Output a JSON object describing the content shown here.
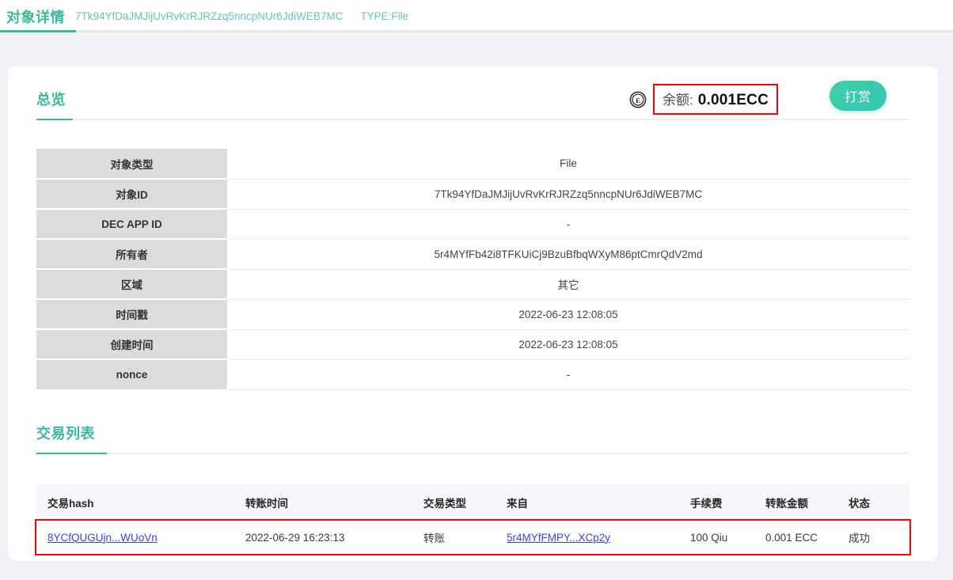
{
  "header": {
    "tab_label": "对象详情",
    "object_id": "7Tk94YfDaJMJijUvRvKrRJRZzq5nncpNUr6JdiWEB7MC",
    "type_label": "TYPE:File"
  },
  "overview": {
    "section_title": "总览",
    "balance_label": "余额:",
    "balance_value": "0.001ECC",
    "coin_icon": "ecc-coin-icon",
    "reward_button": "打赏",
    "rows": [
      {
        "label": "对象类型",
        "value": "File"
      },
      {
        "label": "对象ID",
        "value": "7Tk94YfDaJMJijUvRvKrRJRZzq5nncpNUr6JdiWEB7MC"
      },
      {
        "label": "DEC APP ID",
        "value": "-"
      },
      {
        "label": "所有者",
        "value": "5r4MYfFb42i8TFKUiCj9BzuBfbqWXyM86ptCmrQdV2md"
      },
      {
        "label": "区域",
        "value": "其它"
      },
      {
        "label": "时间戳",
        "value": "2022-06-23 12:08:05"
      },
      {
        "label": "创建时间",
        "value": "2022-06-23 12:08:05"
      },
      {
        "label": "nonce",
        "value": "-"
      }
    ]
  },
  "transactions": {
    "section_title": "交易列表",
    "columns": [
      "交易hash",
      "转账时间",
      "交易类型",
      "来自",
      "手续费",
      "转账金额",
      "状态"
    ],
    "rows": [
      {
        "hash": "8YCfQUGUjn...WUoVn",
        "time": "2022-06-29 16:23:13",
        "type": "转账",
        "from": "5r4MYfFMPY...XCp2y",
        "fee": "100 Qiu",
        "amount": "0.001 ECC",
        "status": "成功"
      }
    ]
  },
  "colors": {
    "accent": "#3cb79e",
    "link": "#4040e8",
    "highlight": "#ff0000",
    "label_bg": "#dcdcdc",
    "page_bg": "#f0f2f5"
  }
}
